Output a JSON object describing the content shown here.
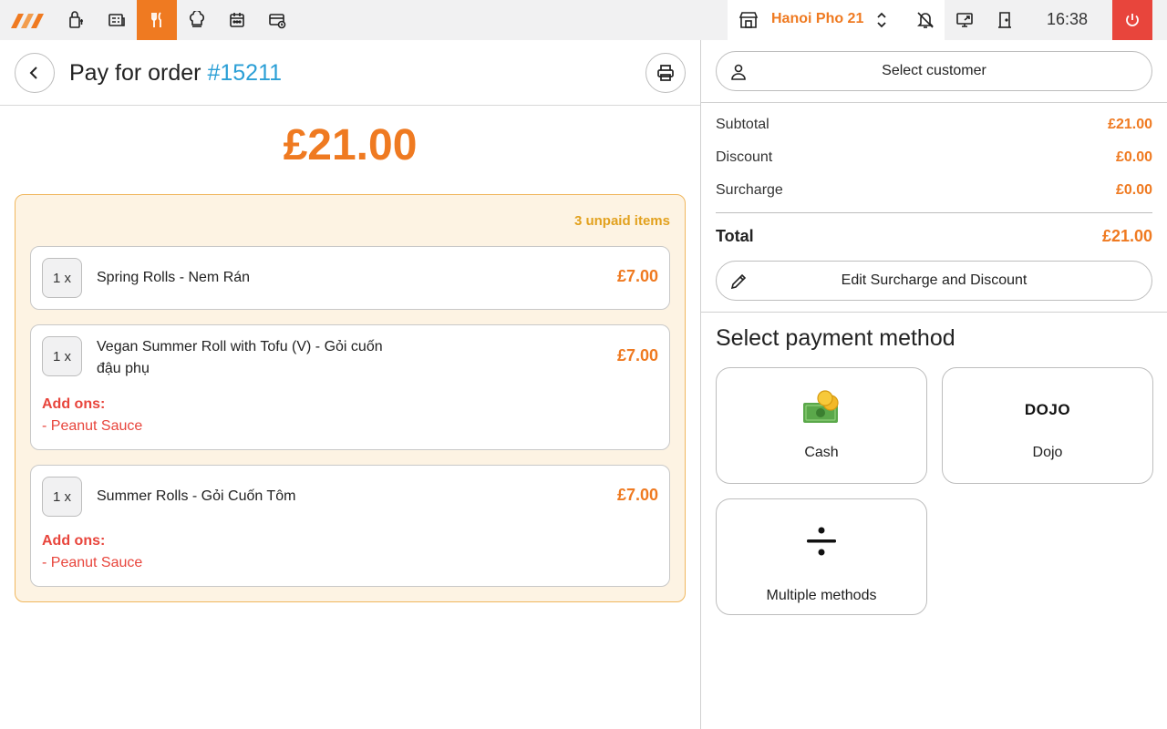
{
  "topbar": {
    "store_name": "Hanoi Pho 21",
    "clock": "16:38",
    "nav_icons": [
      "logo-icon",
      "takeaway-icon",
      "receipt-icon",
      "cutlery-icon",
      "chef-hat-icon",
      "calendar-icon",
      "card-clock-icon"
    ],
    "accent_color": "#ef7a21",
    "power_color": "#e8453c"
  },
  "order": {
    "title_prefix": "Pay for order",
    "order_number": "#15211",
    "amount": "£21.00",
    "unpaid_label": "3 unpaid items",
    "items": [
      {
        "qty": "1 x",
        "name": "Spring Rolls - Nem Rán",
        "price": "£7.00"
      },
      {
        "qty": "1 x",
        "name": "Vegan Summer Roll with Tofu (V) - Gỏi cuốn đậu phụ",
        "price": "£7.00",
        "addons_title": "Add ons:",
        "addons": [
          "- Peanut Sauce"
        ]
      },
      {
        "qty": "1 x",
        "name": "Summer Rolls - Gỏi Cuốn Tôm",
        "price": "£7.00",
        "addons_title": "Add ons:",
        "addons": [
          "- Peanut Sauce"
        ]
      }
    ]
  },
  "summary": {
    "select_customer": "Select customer",
    "subtotal_label": "Subtotal",
    "subtotal": "£21.00",
    "discount_label": "Discount",
    "discount": "£0.00",
    "surcharge_label": "Surcharge",
    "surcharge": "£0.00",
    "total_label": "Total",
    "total": "£21.00",
    "edit_button": "Edit Surcharge and Discount"
  },
  "payment": {
    "title": "Select payment method",
    "methods": [
      {
        "label": "Cash",
        "icon": "cash-icon"
      },
      {
        "label": "Dojo",
        "logo": "DOJO"
      },
      {
        "label": "Multiple methods",
        "icon": "divide-icon"
      }
    ]
  }
}
